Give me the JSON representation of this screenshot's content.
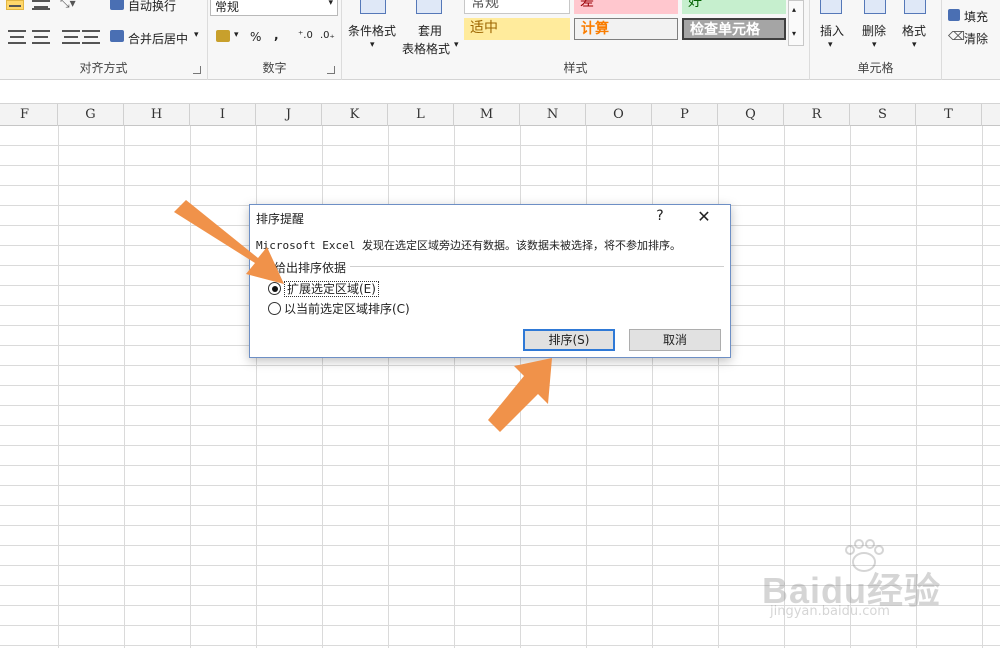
{
  "ribbon": {
    "alignment": {
      "label": "对齐方式",
      "wrap_text": "自动换行",
      "merge_center": "合并后居中"
    },
    "number": {
      "label": "数字",
      "format_value": "常规",
      "percent": "%",
      "comma": ","
    },
    "styles": {
      "label": "样式",
      "conditional_format": "条件格式",
      "table_format_1": "套用",
      "table_format_2": "表格格式",
      "gallery": {
        "normal": "常规",
        "bad": "差",
        "good": "好",
        "neutral": "适中",
        "calculation": "计算",
        "check_cell": "检查单元格"
      }
    },
    "cells": {
      "label": "单元格",
      "insert": "插入",
      "delete": "删除",
      "format": "格式"
    },
    "editing": {
      "fill": "填充",
      "clear": "清除"
    }
  },
  "columns": [
    "F",
    "G",
    "H",
    "I",
    "J",
    "K",
    "L",
    "M",
    "N",
    "O",
    "P",
    "Q",
    "R",
    "S",
    "T"
  ],
  "dialog": {
    "title": "排序提醒",
    "help": "?",
    "close": "✕",
    "message": "Microsoft Excel 发现在选定区域旁边还有数据。该数据未被选择，将不参加排序。",
    "group_label": "给出排序依据",
    "option_expand": "扩展选定区域(E)",
    "option_current": "以当前选定区域排序(C)",
    "selected_option": "option_expand",
    "sort_button": "排序(S)",
    "cancel_button": "取消"
  },
  "colors": {
    "accent": "#2f79d6",
    "annotation_arrow": "#f0924a",
    "style_bad": "#ffc7ce",
    "style_good": "#c6efce",
    "style_neutral": "#ffeb9c",
    "style_check": "#a5a5a5"
  },
  "watermark": {
    "brand": "Baidu经验",
    "url": "jingyan.baidu.com"
  }
}
